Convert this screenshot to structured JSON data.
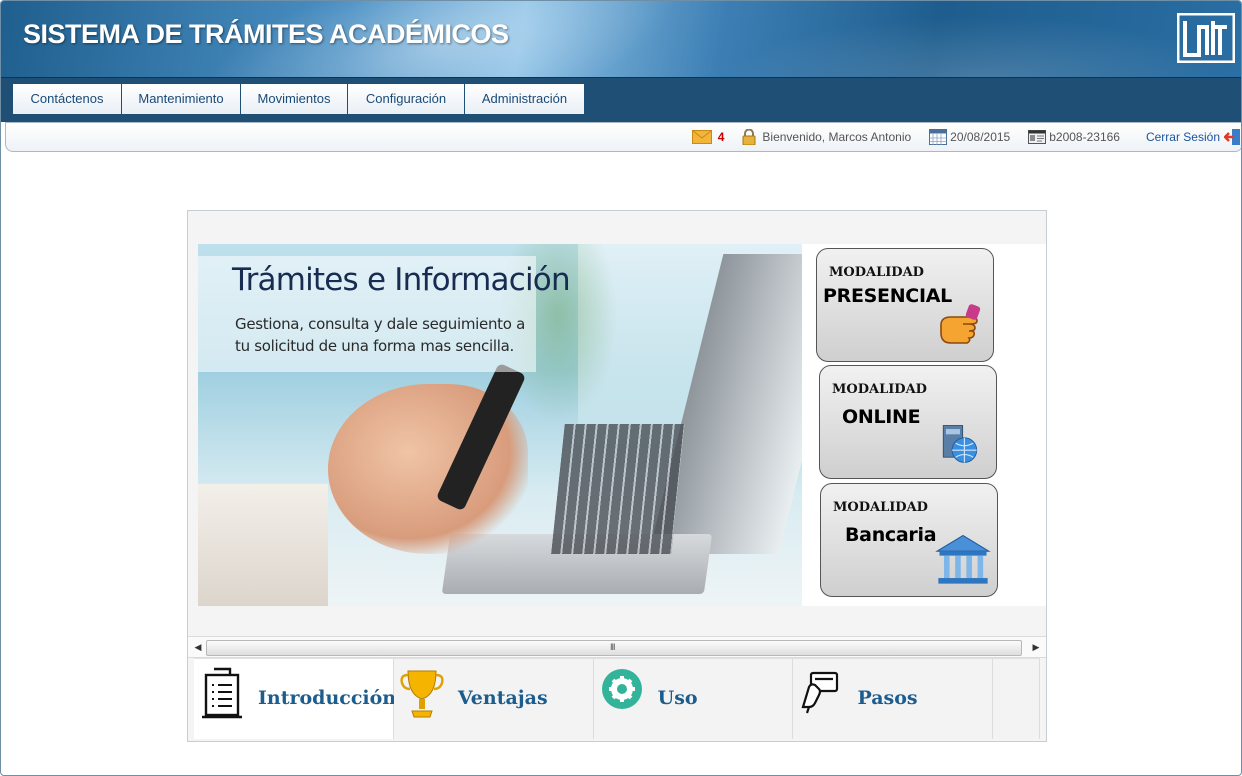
{
  "header": {
    "title": "SISTEMA DE TRÁMITES ACADÉMICOS",
    "logo_icon": "unan-logo-icon"
  },
  "menu": {
    "items": [
      {
        "label": "Contáctenos"
      },
      {
        "label": "Mantenimiento"
      },
      {
        "label": "Movimientos"
      },
      {
        "label": "Configuración"
      },
      {
        "label": "Administración"
      }
    ]
  },
  "status": {
    "mail_count": "4",
    "welcome": "Bienvenido, Marcos Antonio",
    "date": "20/08/2015",
    "user_id": "b2008-23166",
    "logout": "Cerrar Sesión"
  },
  "banner": {
    "title": "Trámites e Información",
    "subtitle": "Gestiona, consulta y dale seguimiento a tu solicitud de una forma mas sencilla."
  },
  "modes": [
    {
      "label": "MODALIDAD",
      "name": "PRESENCIAL",
      "icon": "pointing-hand-icon"
    },
    {
      "label": "MODALIDAD",
      "name": "ONLINE",
      "icon": "computer-globe-icon"
    },
    {
      "label": "MODALIDAD",
      "name": "Bancaria",
      "icon": "bank-icon"
    }
  ],
  "scrollbar": {
    "grip": "III"
  },
  "tabs": [
    {
      "label": "Introducción",
      "icon": "document-list-icon"
    },
    {
      "label": "Ventajas",
      "icon": "trophy-icon"
    },
    {
      "label": "Uso",
      "icon": "gear-icon"
    },
    {
      "label": "Pasos",
      "icon": "hand-card-icon"
    }
  ],
  "colors": {
    "header_blue": "#2a6ea3",
    "menu_bar": "#1f4f74",
    "tab_text": "#1d5d8e",
    "mail_count": "#cc0000",
    "logout_link": "#1a55a0"
  }
}
